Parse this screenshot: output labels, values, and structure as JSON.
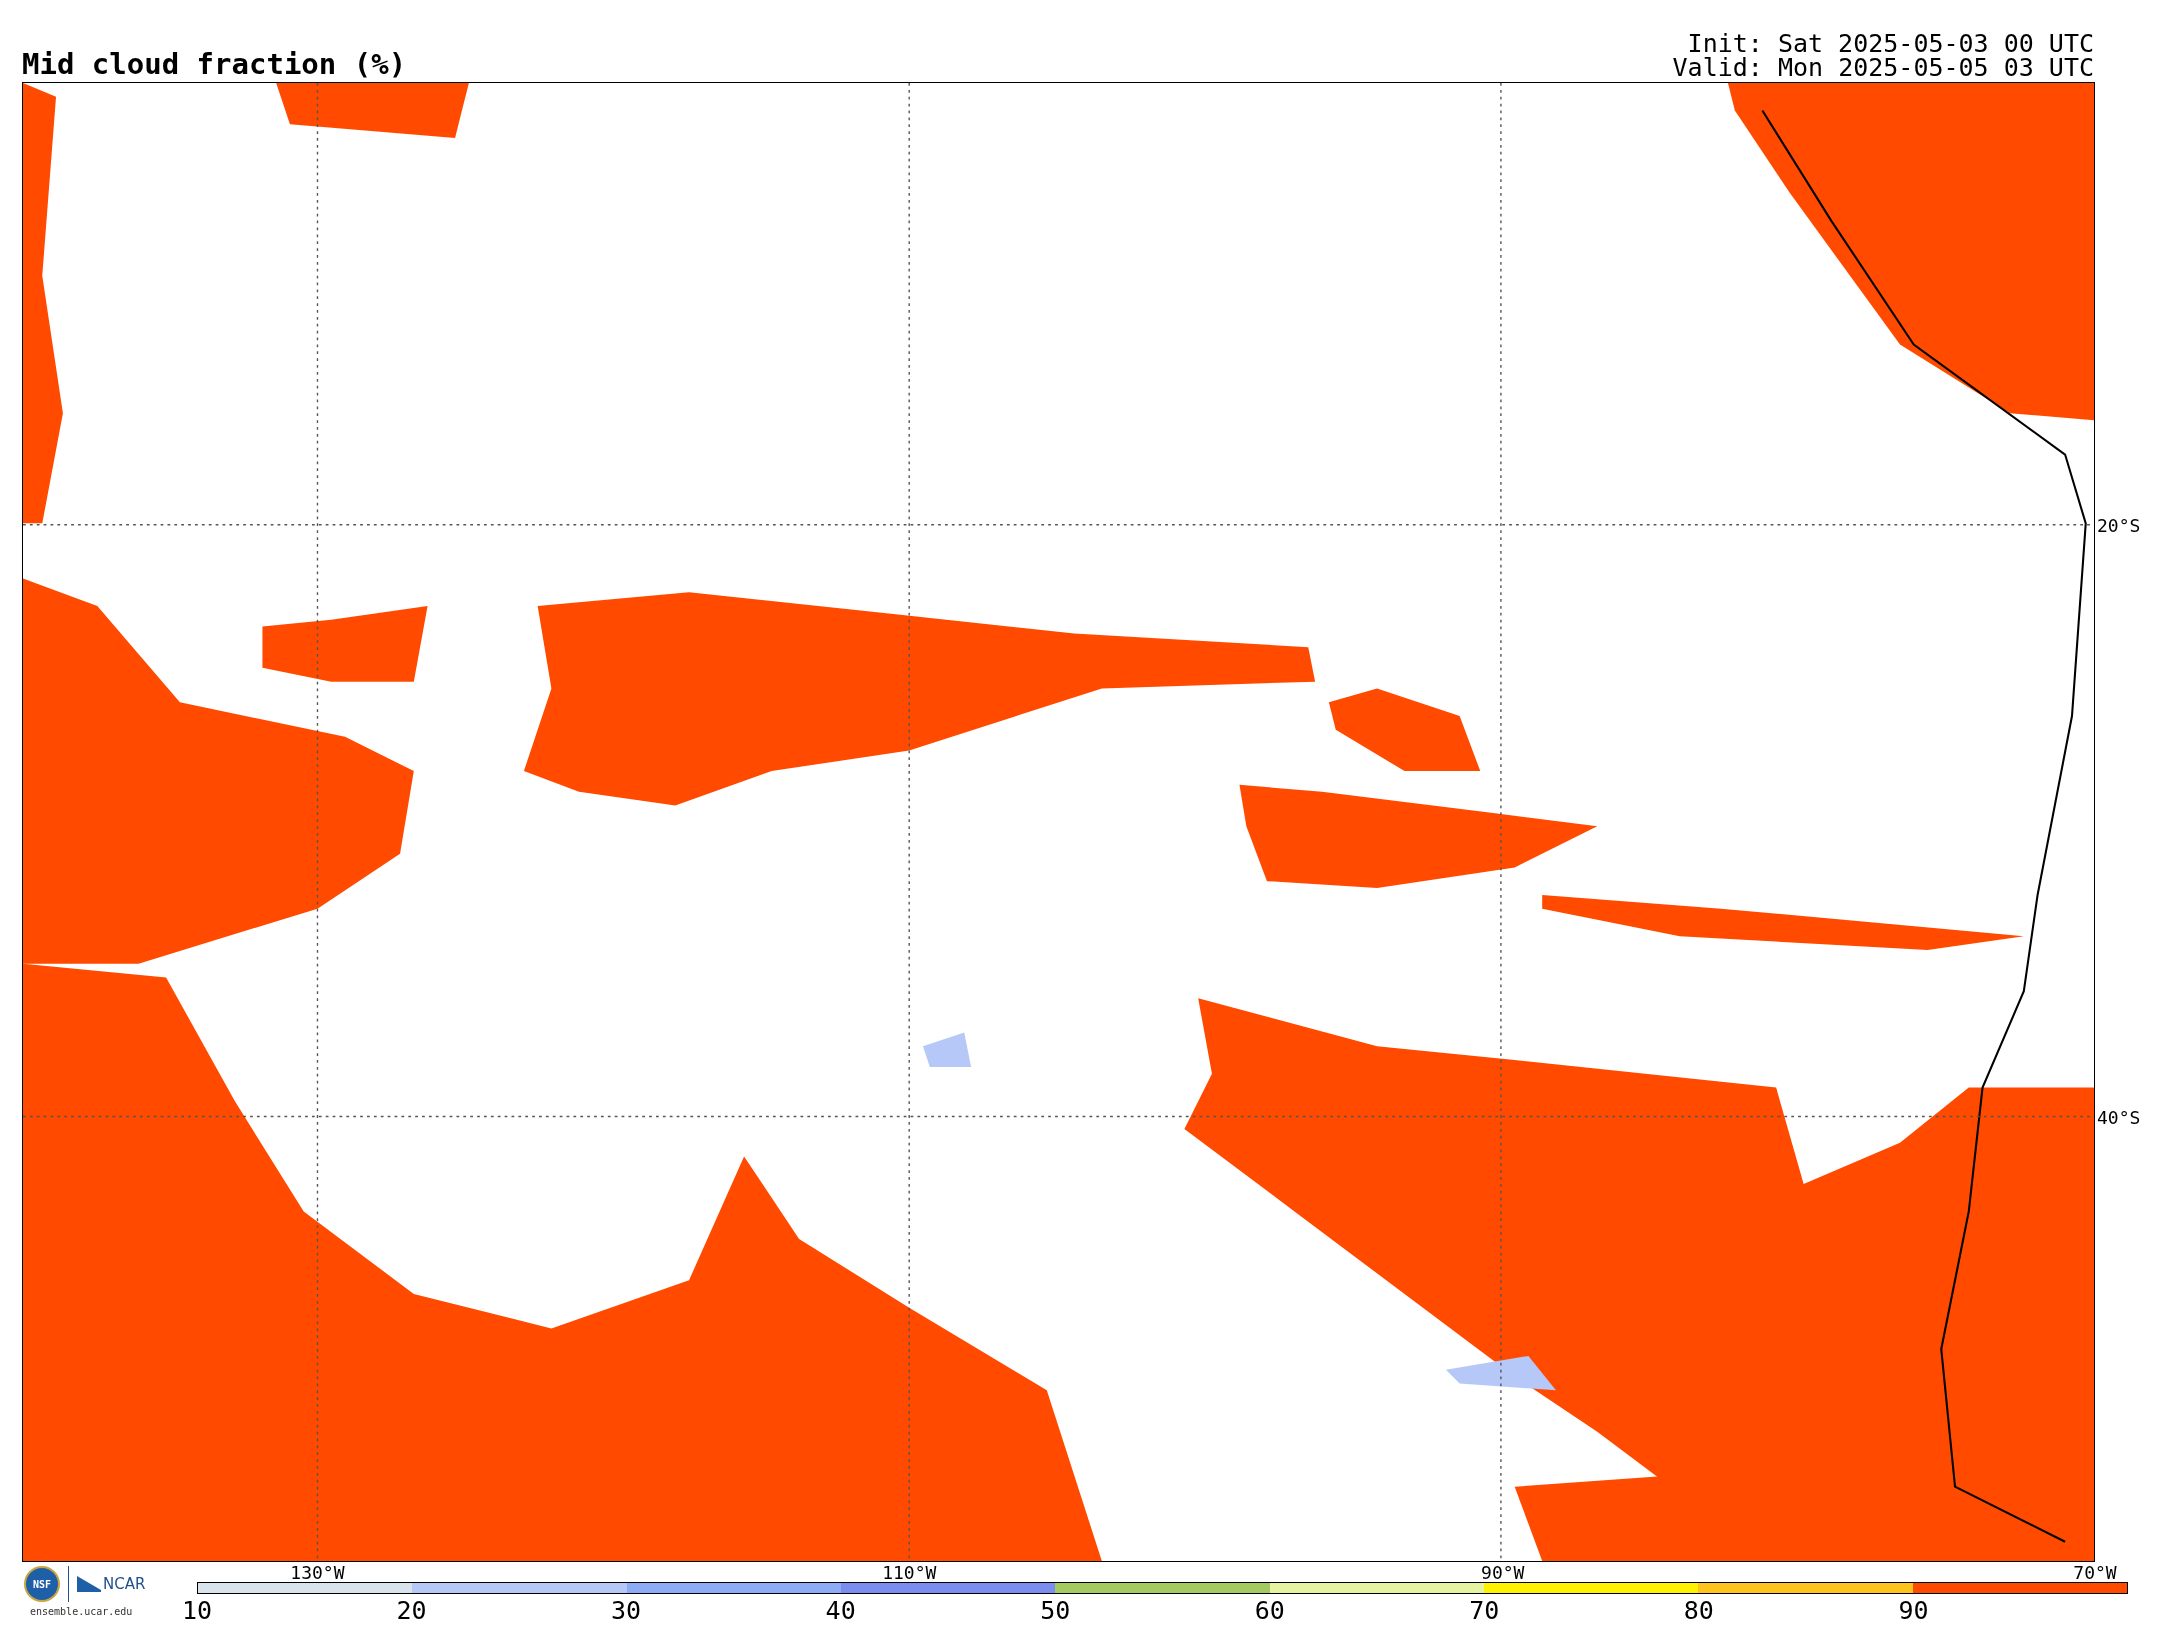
{
  "title": "Mid cloud fraction (%)",
  "init": "Init: Sat 2025-05-03 00 UTC",
  "valid": "Valid: Mon 2025-05-05 03 UTC",
  "map": {
    "lat_labels": [
      "20°S",
      "40°S"
    ],
    "lon_labels": [
      "130°W",
      "110°W",
      "90°W",
      "70°W"
    ]
  },
  "colorbar": {
    "bins": [
      {
        "color": "#d8e3ec"
      },
      {
        "color": "#b6c8f7"
      },
      {
        "color": "#8eabf5"
      },
      {
        "color": "#7b8ef0"
      },
      {
        "color": "#a6ca62"
      },
      {
        "color": "#e6f4a2"
      },
      {
        "color": "#fff200"
      },
      {
        "color": "#ffc31f"
      },
      {
        "color": "#ff4a00"
      }
    ],
    "ticks": [
      "10",
      "20",
      "30",
      "40",
      "50",
      "60",
      "70",
      "80",
      "90"
    ]
  },
  "logos": {
    "nsf": "NSF",
    "ncar": "NCAR",
    "url": "ensemble.ucar.edu"
  }
}
